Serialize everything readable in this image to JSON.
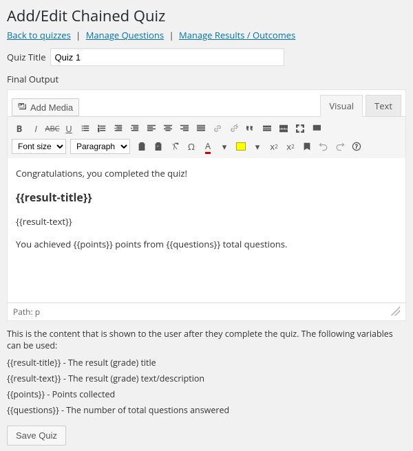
{
  "title": "Add/Edit Chained Quiz",
  "links": {
    "back": "Back to quizzes",
    "manage_q": "Manage Questions",
    "manage_r": "Manage Results / Outcomes"
  },
  "quiz_title_label": "Quiz Title",
  "quiz_title_value": "Quiz 1",
  "final_output_label": "Final Output",
  "media_btn": "Add Media",
  "tabs": {
    "visual": "Visual",
    "text": "Text"
  },
  "font_size_placeholder": "Font size",
  "format_placeholder": "Paragraph",
  "editor": {
    "p1": "Congratulations, you completed the quiz!",
    "h": "{{result-title}}",
    "p2": "{{result-text}}",
    "p3": "You achieved {{points}} points from {{questions}} total questions."
  },
  "path_label": "Path: p",
  "help_text": "This is the content that is shown to the user after they complete the quiz. The following variables can be used:",
  "vars": {
    "v1": "{{result-title}} - The result (grade) title",
    "v2": "{{result-text}} - The result (grade) text/description",
    "v3": "{{points}} - Points collected",
    "v4": "{{questions}} - The number of total questions answered"
  },
  "save_btn": "Save Quiz"
}
